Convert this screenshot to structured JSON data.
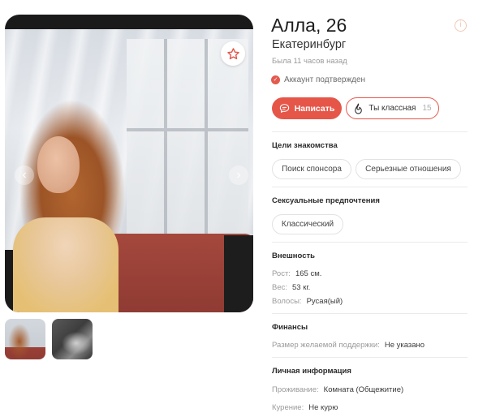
{
  "profile": {
    "name_age": "Алла, 26",
    "city": "Екатеринбург",
    "last_seen": "Была 11 часов назад",
    "verified_label": "Аккаунт подтвержден"
  },
  "actions": {
    "write_label": "Написать",
    "like_label": "Ты классная",
    "like_count": "15"
  },
  "sections": {
    "goals": {
      "title": "Цели знакомства",
      "chips": [
        "Поиск спонсора",
        "Серьезные отношения"
      ]
    },
    "preferences": {
      "title": "Сексуальные предпочтения",
      "chips": [
        "Классический"
      ]
    },
    "appearance": {
      "title": "Внешность",
      "rows": [
        {
          "label": "Рост:",
          "value": "165 см."
        },
        {
          "label": "Вес:",
          "value": "53 кг."
        },
        {
          "label": "Волосы:",
          "value": "Русая(ый)"
        }
      ]
    },
    "finances": {
      "title": "Финансы",
      "rows": [
        {
          "label": "Размер желаемой поддержки:",
          "value": "Не указано"
        }
      ]
    },
    "personal": {
      "title": "Личная информация",
      "rows": [
        {
          "label": "Проживание:",
          "value": "Комната (Общежитие)"
        },
        {
          "label": "Курение:",
          "value": "Не курю"
        }
      ]
    }
  },
  "icons": {
    "favorite": "star-icon",
    "info": "info-icon",
    "verified": "check-circle-icon",
    "write": "chat-bubble-icon",
    "like": "flame-icon"
  },
  "colors": {
    "accent": "#e55649",
    "muted_text": "#9a9a9a",
    "divider": "#ebebeb"
  },
  "gallery": {
    "thumbnail_count": 2
  }
}
